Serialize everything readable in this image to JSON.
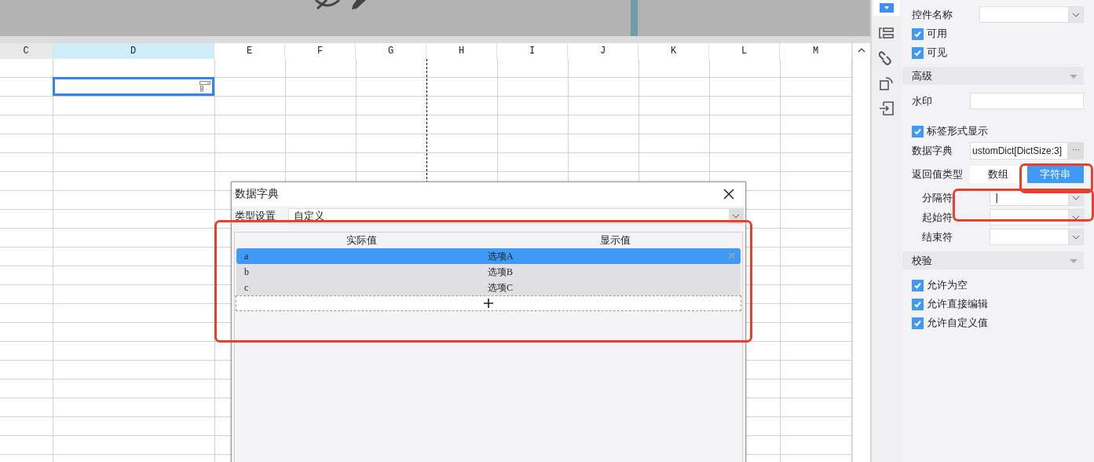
{
  "sheet": {
    "columns": [
      {
        "label": "C",
        "selected": false
      },
      {
        "label": "D",
        "selected": true
      },
      {
        "label": "E",
        "selected": false
      },
      {
        "label": "F",
        "selected": false
      },
      {
        "label": "G",
        "selected": false
      },
      {
        "label": "H",
        "selected": false
      },
      {
        "label": "I",
        "selected": false
      },
      {
        "label": "J",
        "selected": false
      },
      {
        "label": "K",
        "selected": false
      },
      {
        "label": "L",
        "selected": false
      },
      {
        "label": "M",
        "selected": false
      }
    ]
  },
  "toolbar": {
    "tools": [
      {
        "kind": "combo",
        "selected": true
      },
      {
        "kind": "form",
        "selected": false
      },
      {
        "kind": "link",
        "selected": false
      },
      {
        "kind": "rotate",
        "selected": false
      },
      {
        "kind": "import",
        "selected": false
      }
    ]
  },
  "properties": {
    "rows": [
      {
        "kind": "select",
        "label": "控件名称",
        "indented": false
      },
      {
        "kind": "checkbox",
        "label": "可用",
        "checked": true
      },
      {
        "kind": "checkbox",
        "label": "可见",
        "checked": true
      },
      {
        "kind": "section",
        "label": "高级",
        "expanded": true
      },
      {
        "kind": "text",
        "label": "水印"
      },
      {
        "kind": "checkbox",
        "label": "标签形式显示",
        "checked": true
      },
      {
        "kind": "dict",
        "label": "数据字典",
        "value": "ustomDict[DictSize:3]",
        "button": "···"
      },
      {
        "kind": "segmented",
        "label": "返回值类型",
        "options": [
          {
            "label": "数组",
            "selected": false
          },
          {
            "label": "字符串",
            "selected": true
          }
        ]
      },
      {
        "kind": "select",
        "label": "分隔符",
        "value": "|",
        "indented": true
      },
      {
        "kind": "select",
        "label": "起始符",
        "indented": true
      },
      {
        "kind": "select",
        "label": "结束符",
        "indented": true
      },
      {
        "kind": "section",
        "label": "校验",
        "expanded": true
      },
      {
        "kind": "checkbox",
        "label": "允许为空",
        "checked": true
      },
      {
        "kind": "checkbox",
        "label": "允许直接编辑",
        "checked": true
      },
      {
        "kind": "checkbox",
        "label": "允许自定义值",
        "checked": true
      }
    ]
  },
  "dialog": {
    "title": "数据字典",
    "type_label": "类型设置",
    "type_value": "自定义",
    "columns": [
      "实际值",
      "显示值"
    ],
    "rows": [
      {
        "actual": "a",
        "display": "选项A",
        "selected": true
      },
      {
        "actual": "b",
        "display": "选项B",
        "selected": false
      },
      {
        "actual": "c",
        "display": "选项C",
        "selected": false
      }
    ]
  }
}
